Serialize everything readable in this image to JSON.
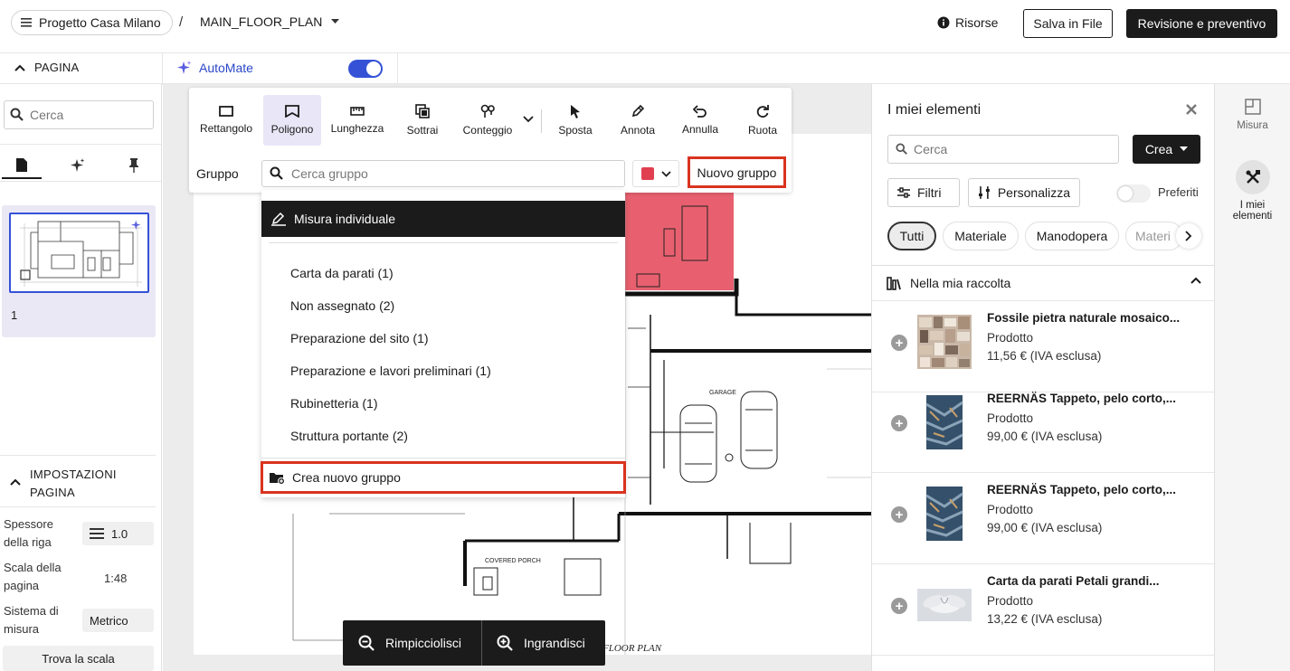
{
  "header": {
    "project_name": "Progetto Casa Milano",
    "separator": "/",
    "plan_name": "MAIN_FLOOR_PLAN",
    "resources_label": "Risorse",
    "save_label": "Salva in File",
    "review_label": "Revisione e preventivo"
  },
  "subbar": {
    "page_label": "PAGINA",
    "automate_label": "AutoMate",
    "automate_on": true
  },
  "left_panel": {
    "search_placeholder": "Cerca",
    "page_number": "1",
    "settings": {
      "title": "IMPOSTAZIONI PAGINA",
      "line_thickness_label": "Spessore della riga",
      "line_thickness_value": "1.0",
      "page_scale_label": "Scala della pagina",
      "page_scale_value": "1:48",
      "measure_system_label": "Sistema di misura",
      "measure_system_value": "Metrico",
      "find_scale_label": "Trova la scala"
    }
  },
  "toolbar": {
    "tools": [
      {
        "label": "Rettangolo",
        "icon": "rectangle-icon"
      },
      {
        "label": "Poligono",
        "icon": "polygon-icon",
        "active": true
      },
      {
        "label": "Lunghezza",
        "icon": "ruler-icon"
      },
      {
        "label": "Sottrai",
        "icon": "subtract-icon"
      },
      {
        "label": "Conteggio",
        "icon": "count-icon"
      },
      {
        "label": "Sposta",
        "icon": "cursor-icon"
      },
      {
        "label": "Annota",
        "icon": "pen-icon"
      },
      {
        "label": "Annulla",
        "icon": "undo-icon"
      },
      {
        "label": "Ruota",
        "icon": "rotate-icon"
      }
    ],
    "group_label": "Gruppo",
    "group_search_placeholder": "Cerca gruppo",
    "group_color": "#e0404f",
    "new_group_label": "Nuovo gruppo"
  },
  "dropdown": {
    "header": "Misura individuale",
    "items": [
      "Carta da parati (1)",
      "Non assegnato (2)",
      "Preparazione del sito (1)",
      "Preparazione e lavori preliminari (1)",
      "Rubinetteria (1)",
      "Struttura portante (2)"
    ],
    "create_label": "Crea nuovo gruppo"
  },
  "zoom": {
    "zoom_out_label": "Rimpicciolisci",
    "zoom_in_label": "Ingrandisci"
  },
  "plan": {
    "room_label": "GARAGE",
    "covered_label": "COVERED PORCH",
    "title_fragment": "FLOOR PLAN",
    "highlight_color": "#e8606f"
  },
  "right_panel": {
    "title": "I miei elementi",
    "search_placeholder": "Cerca",
    "create_label": "Crea",
    "filters_label": "Filtri",
    "customize_label": "Personalizza",
    "favorites_label": "Preferiti",
    "chips": [
      "Tutti",
      "Materiale",
      "Manodopera",
      "Materi"
    ],
    "collection_label": "Nella mia raccolta",
    "products": [
      {
        "name": "Fossile pietra naturale mosaico...",
        "type": "Prodotto",
        "price": "11,56 € (IVA esclusa)"
      },
      {
        "name": "REERNÄS Tappeto, pelo corto,...",
        "type": "Prodotto",
        "price": "99,00 € (IVA esclusa)"
      },
      {
        "name": "REERNÄS Tappeto, pelo corto,...",
        "type": "Prodotto",
        "price": "99,00 € (IVA esclusa)"
      },
      {
        "name": "Carta da parati Petali grandi...",
        "type": "Prodotto",
        "price": "13,22 € (IVA esclusa)"
      }
    ]
  },
  "rail": {
    "measure_label": "Misura",
    "my_items_label": "I miei elementi"
  }
}
